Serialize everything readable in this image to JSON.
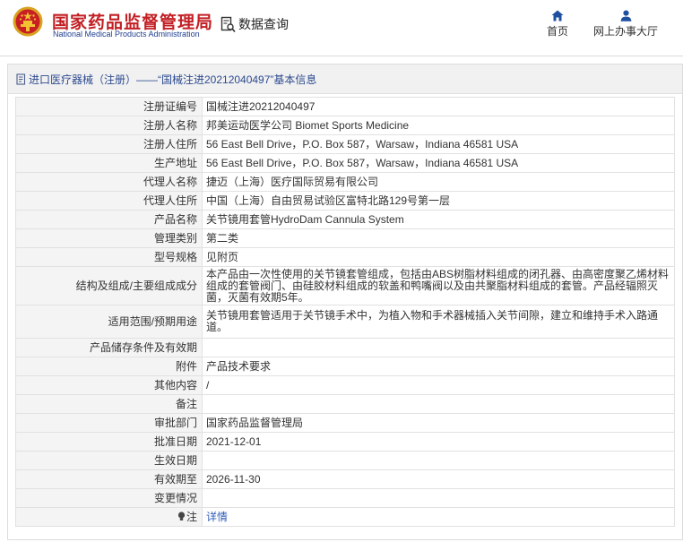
{
  "header": {
    "brand_cn": "国家药品监督管理局",
    "brand_en": "National Medical Products Administration",
    "query_label": "数据查询",
    "nav": {
      "home": "首页",
      "online_hall": "网上办事大厅"
    }
  },
  "breadcrumb": {
    "text": "进口医疗器械（注册）——“国械注进20212040497”基本信息"
  },
  "fields": [
    {
      "key": "注册证编号",
      "value": "国械注进20212040497"
    },
    {
      "key": "注册人名称",
      "value": "邦美运动医学公司 Biomet Sports Medicine"
    },
    {
      "key": "注册人住所",
      "value": "56 East Bell Drive，P.O. Box 587，Warsaw，Indiana 46581 USA"
    },
    {
      "key": "生产地址",
      "value": "56 East Bell Drive，P.O. Box 587，Warsaw，Indiana 46581 USA"
    },
    {
      "key": "代理人名称",
      "value": "捷迈（上海）医疗国际贸易有限公司"
    },
    {
      "key": "代理人住所",
      "value": "中国（上海）自由贸易试验区富特北路129号第一层"
    },
    {
      "key": "产品名称",
      "value": "关节镜用套管HydroDam Cannula System"
    },
    {
      "key": "管理类别",
      "value": "第二类"
    },
    {
      "key": "型号规格",
      "value": "见附页"
    },
    {
      "key": "结构及组成/主要组成成分",
      "value": "本产品由一次性使用的关节镜套管组成，包括由ABS树脂材料组成的闭孔器、由高密度聚乙烯材料组成的套管阀门、由硅胶材料组成的软盖和鸭嘴阀以及由共聚脂材料组成的套管。产品经辐照灭菌，灭菌有效期5年。"
    },
    {
      "key": "适用范围/预期用途",
      "value": "关节镜用套管适用于关节镜手术中，为植入物和手术器械插入关节间隙，建立和维持手术入路通道。"
    },
    {
      "key": "产品储存条件及有效期",
      "value": ""
    },
    {
      "key": "附件",
      "value": "产品技术要求"
    },
    {
      "key": "其他内容",
      "value": "/"
    },
    {
      "key": "备注",
      "value": ""
    },
    {
      "key": "审批部门",
      "value": "国家药品监督管理局"
    },
    {
      "key": "批准日期",
      "value": "2021-12-01"
    },
    {
      "key": "生效日期",
      "value": ""
    },
    {
      "key": "有效期至",
      "value": "2026-11-30"
    },
    {
      "key": "变更情况",
      "value": ""
    }
  ],
  "note_row": {
    "key": "注",
    "link": "详情"
  },
  "icons": {
    "logo": "national-emblem-icon",
    "query": "search-document-icon",
    "home": "home-icon",
    "online_hall": "user-icon",
    "title": "document-icon",
    "note": "lightbulb-icon"
  },
  "colors": {
    "brand_red": "#c21f24",
    "brand_blue": "#1f3f8f",
    "nav_blue": "#1f4f9f",
    "link_blue": "#2f5db8"
  }
}
